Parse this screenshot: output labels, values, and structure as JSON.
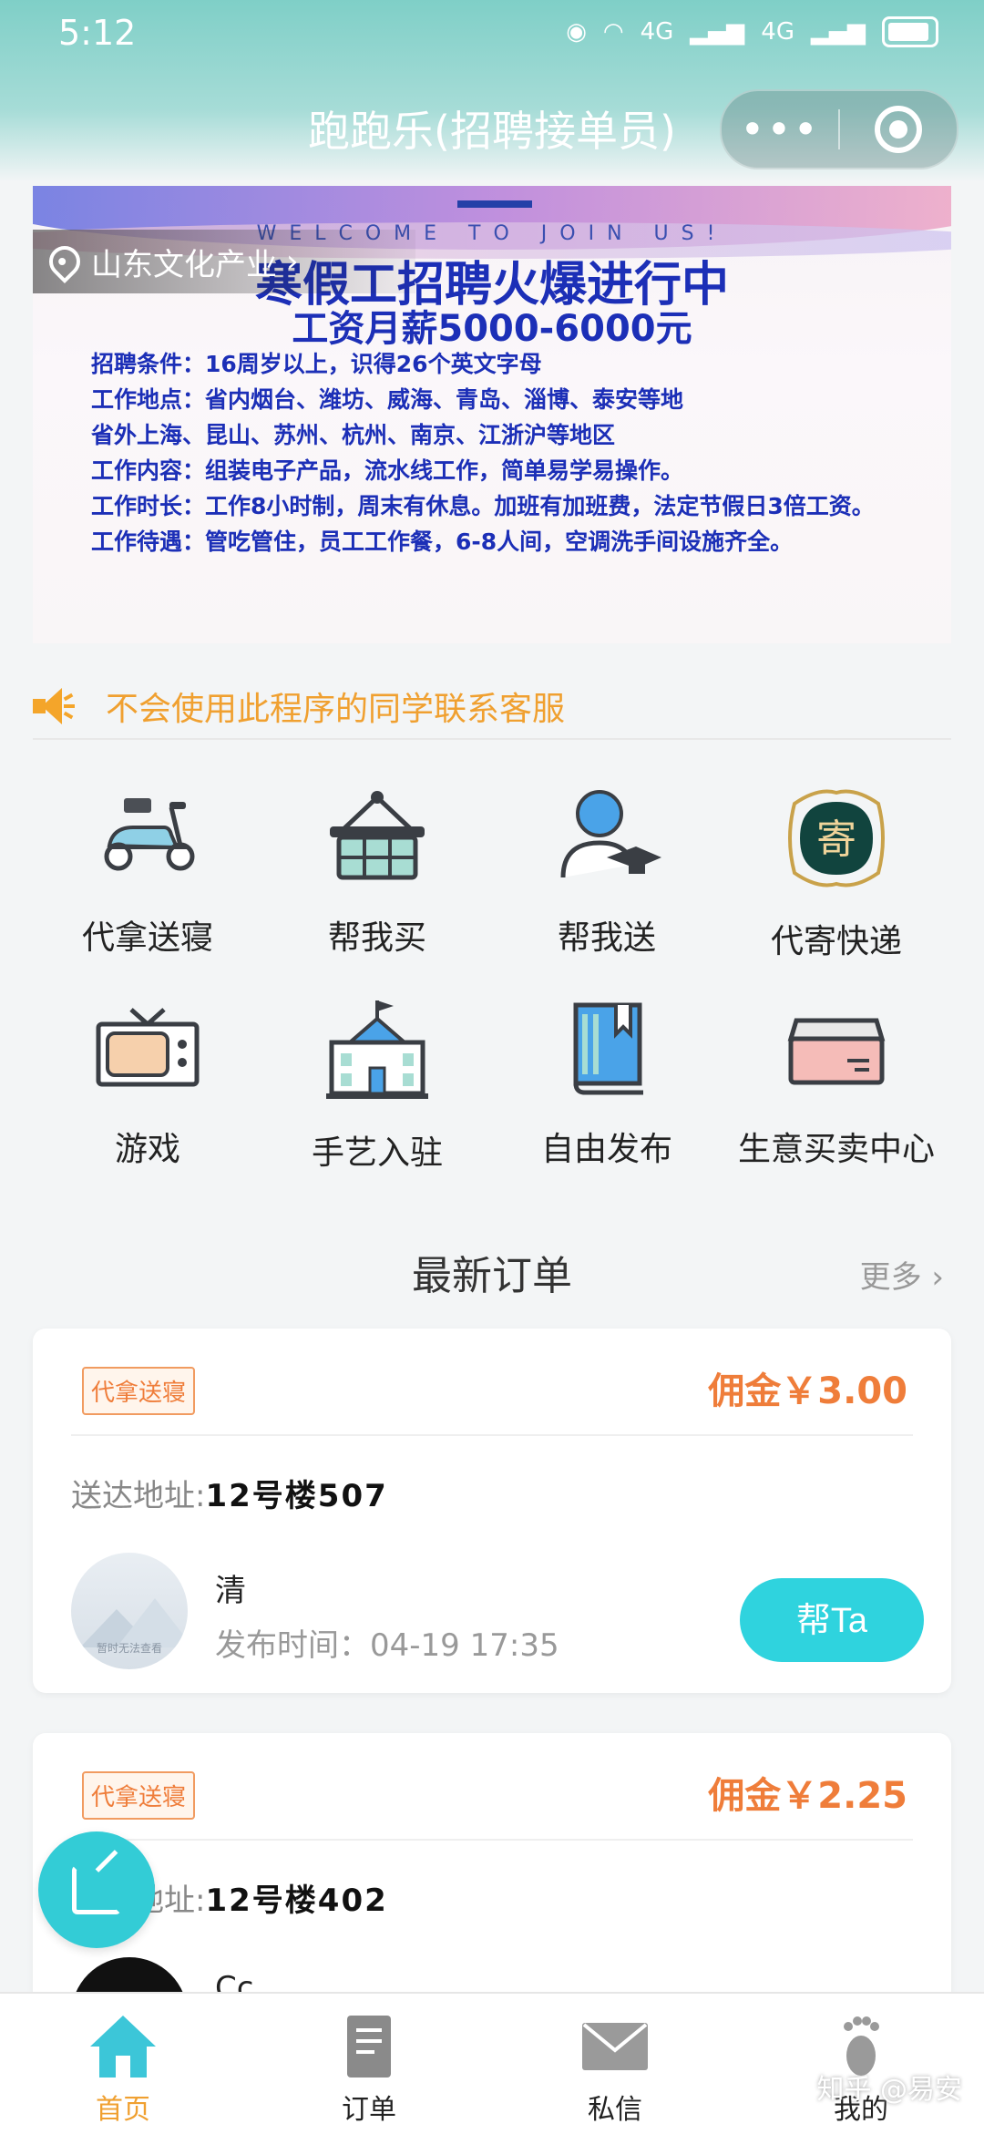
{
  "status_bar": {
    "time": "5:12",
    "net1": "4G",
    "net2": "4G"
  },
  "app": {
    "title": "跑跑乐(招聘接单员)"
  },
  "banner": {
    "location": "山东文化产业",
    "welcome": "WELCOME TO JOIN US!",
    "headline": "寒假工招聘火爆进行中",
    "salary": "工资月薪5000-6000元",
    "lines": [
      "招聘条件：16周岁以上，识得26个英文字母",
      "工作地点：省内烟台、潍坊、威海、青岛、淄博、泰安等地",
      "省外上海、昆山、苏州、杭州、南京、江浙沪等地区",
      "工作内容：组装电子产品，流水线工作，简单易学易操作。",
      "工作时长：工作8小时制，周末有休息。加班有加班费，法定节假日3倍工资。",
      "工作待遇：管吃管住，员工工作餐，6-8人间，空调洗手间设施齐全。"
    ]
  },
  "notice": {
    "text": "不会使用此程序的同学联系客服"
  },
  "services": [
    {
      "label": "代拿送寝",
      "icon": "scooter-icon"
    },
    {
      "label": "帮我买",
      "icon": "basket-icon"
    },
    {
      "label": "帮我送",
      "icon": "graduate-icon"
    },
    {
      "label": "代寄快递",
      "icon": "mail-badge-icon",
      "glyph": "寄"
    },
    {
      "label": "游戏",
      "icon": "tv-icon"
    },
    {
      "label": "手艺入驻",
      "icon": "school-icon"
    },
    {
      "label": "自由发布",
      "icon": "book-icon"
    },
    {
      "label": "生意买卖中心",
      "icon": "card-icon"
    }
  ],
  "orders_section": {
    "title": "最新订单",
    "more": "更多"
  },
  "orders": [
    {
      "tag": "代拿送寝",
      "fee": "佣金￥3.00",
      "addr_label": "送达地址:",
      "addr_value": "12号楼507",
      "user": "清",
      "time": "发布时间：04-19 17:35",
      "button": "帮Ta",
      "avatar_caption": "暂时无法查看"
    },
    {
      "tag": "代拿送寝",
      "fee": "佣金￥2.25",
      "addr_label": "送达地址:",
      "addr_value": "12号楼402",
      "user": "Cc."
    }
  ],
  "tabs": [
    {
      "label": "首页",
      "icon": "home-icon",
      "active": true
    },
    {
      "label": "订单",
      "icon": "order-doc-icon"
    },
    {
      "label": "私信",
      "icon": "envelope-icon"
    },
    {
      "label": "我的",
      "icon": "footprint-icon"
    }
  ],
  "watermark": "知乎 @易安",
  "colors": {
    "accent": "#2fd3de",
    "orange": "#ef7d3a",
    "notice": "#f0a030",
    "banner_text": "#1c2fb7"
  }
}
